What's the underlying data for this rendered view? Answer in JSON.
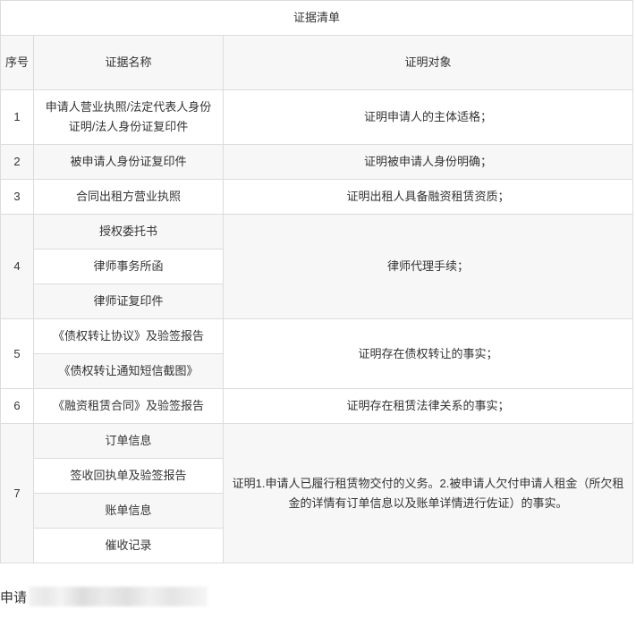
{
  "table": {
    "title": "证据清单",
    "headers": {
      "seq": "序号",
      "name": "证据名称",
      "purpose": "证明对象"
    },
    "groups": [
      {
        "seq": "1",
        "items": [
          "申请人营业执照/法定代表人身份证明/法人身份证复印件"
        ],
        "purpose": "证明申请人的主体适格；"
      },
      {
        "seq": "2",
        "items": [
          "被申请人身份证复印件"
        ],
        "purpose": "证明被申请人身份明确；"
      },
      {
        "seq": "3",
        "items": [
          "合同出租方营业执照"
        ],
        "purpose": "证明出租人具备融资租赁资质；"
      },
      {
        "seq": "4",
        "items": [
          "授权委托书",
          "律师事务所函",
          "律师证复印件"
        ],
        "purpose": "律师代理手续；"
      },
      {
        "seq": "5",
        "items": [
          "《债权转让协议》及验签报告",
          "《债权转让通知短信截图》"
        ],
        "purpose": "证明存在债权转让的事实；"
      },
      {
        "seq": "6",
        "items": [
          "《融资租赁合同》及验签报告"
        ],
        "purpose": "证明存在租赁法律关系的事实；"
      },
      {
        "seq": "7",
        "items": [
          "订单信息",
          "签收回执单及验签报告",
          "账单信息",
          "催收记录"
        ],
        "purpose": "证明1.申请人已履行租赁物交付的义务。2.被申请人欠付申请人租金（所欠租金的详情有订单信息以及账单详情进行佐证）的事实。"
      }
    ]
  },
  "footer": {
    "label": "申请"
  }
}
